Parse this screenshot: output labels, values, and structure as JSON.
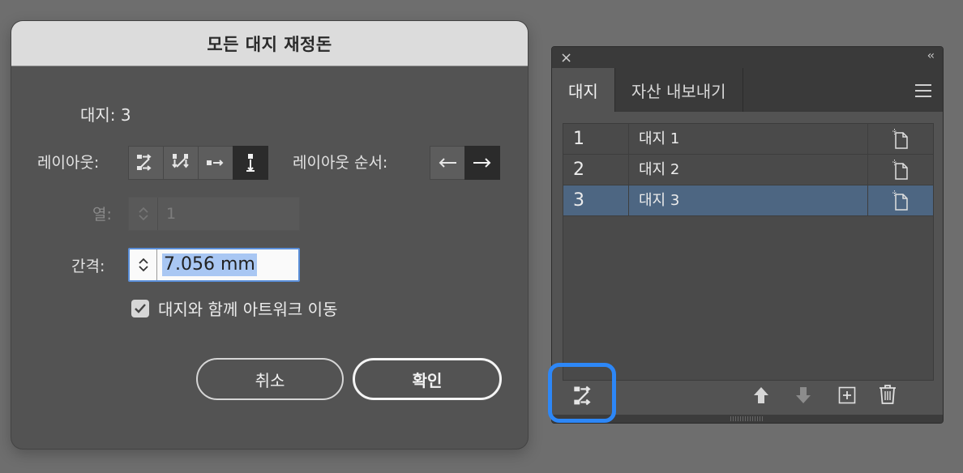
{
  "dialog": {
    "title": "모든 대지 재정돈",
    "artboards_count": "대지: 3",
    "layout_label": "레이아웃:",
    "layout_order_label": "레이아웃 순서:",
    "columns_label": "열:",
    "columns_value": "1",
    "spacing_label": "간격:",
    "spacing_value": "7.056 mm",
    "move_artwork_label": "대지와 함께 아트워크 이동",
    "move_artwork_checked": true,
    "cancel_label": "취소",
    "ok_label": "확인"
  },
  "panel": {
    "tabs": [
      {
        "label": "대지",
        "active": true
      },
      {
        "label": "자산 내보내기",
        "active": false
      }
    ],
    "rows": [
      {
        "num": "1",
        "name": "대지 1",
        "selected": false
      },
      {
        "num": "2",
        "name": "대지 2",
        "selected": false
      },
      {
        "num": "3",
        "name": "대지 3",
        "selected": true
      }
    ]
  },
  "colors": {
    "highlight": "#2d87f7",
    "selected_row": "#4d6682"
  }
}
